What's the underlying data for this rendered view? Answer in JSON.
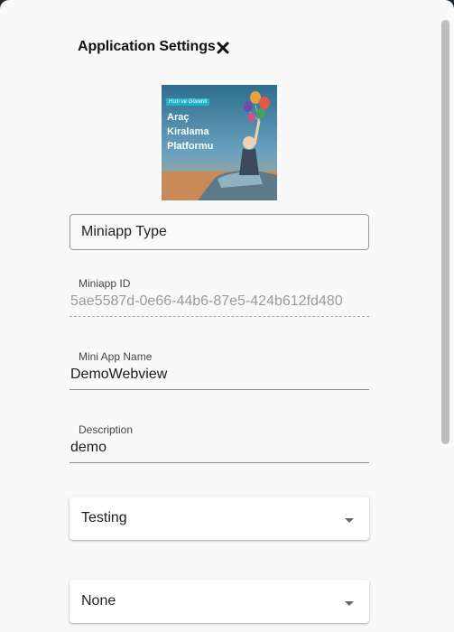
{
  "dialog": {
    "title": "Application Settings",
    "close_icon": "close-icon"
  },
  "thumbnail": {
    "badge": "Hızlı ve Güvenli",
    "title": "Araç Kiralama Platformu"
  },
  "fields": {
    "miniapp_type": {
      "value": "Miniapp Type"
    },
    "miniapp_id": {
      "label": "Miniapp ID",
      "value": "5ae5587d-0e66-44b6-87e5-424b612fd480"
    },
    "mini_app_name": {
      "label": "Mini App Name",
      "value": "DemoWebview"
    },
    "description": {
      "label": "Description",
      "value": "demo"
    }
  },
  "selects": {
    "environment": {
      "value": "Testing"
    },
    "option": {
      "value": "None"
    }
  },
  "colors": {
    "dialog_bg": "#f9f9f9",
    "backdrop": "#1f2a38",
    "badge": "#1fb5c9"
  }
}
